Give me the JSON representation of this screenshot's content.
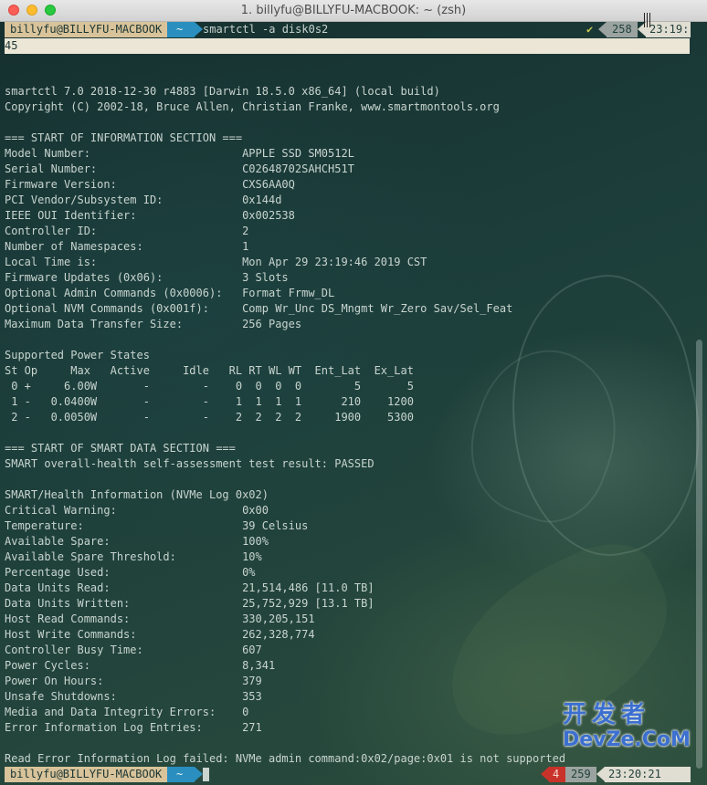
{
  "window": {
    "title": "1. billyfu@BILLYFU-MACBOOK: ~ (zsh)"
  },
  "prompt1": {
    "user": "billyfu@BILLYFU-MACBOOK",
    "dir": "~",
    "command": "smartctl -a disk0s2",
    "status": "✔",
    "history": "258",
    "time": "23:19:",
    "wrapped": "45"
  },
  "output": [
    "",
    "smartctl 7.0 2018-12-30 r4883 [Darwin 18.5.0 x86_64] (local build)",
    "Copyright (C) 2002-18, Bruce Allen, Christian Franke, www.smartmontools.org",
    "",
    "=== START OF INFORMATION SECTION ===",
    "Model Number:                       APPLE SSD SM0512L",
    "Serial Number:                      C02648702SAHCH51T",
    "Firmware Version:                   CXS6AA0Q",
    "PCI Vendor/Subsystem ID:            0x144d",
    "IEEE OUI Identifier:                0x002538",
    "Controller ID:                      2",
    "Number of Namespaces:               1",
    "Local Time is:                      Mon Apr 29 23:19:46 2019 CST",
    "Firmware Updates (0x06):            3 Slots",
    "Optional Admin Commands (0x0006):   Format Frmw_DL",
    "Optional NVM Commands (0x001f):     Comp Wr_Unc DS_Mngmt Wr_Zero Sav/Sel_Feat",
    "Maximum Data Transfer Size:         256 Pages",
    "",
    "Supported Power States",
    "St Op     Max   Active     Idle   RL RT WL WT  Ent_Lat  Ex_Lat",
    " 0 +     6.00W       -        -    0  0  0  0        5       5",
    " 1 -   0.0400W       -        -    1  1  1  1      210    1200",
    " 2 -   0.0050W       -        -    2  2  2  2     1900    5300",
    "",
    "=== START OF SMART DATA SECTION ===",
    "SMART overall-health self-assessment test result: PASSED",
    "",
    "SMART/Health Information (NVMe Log 0x02)",
    "Critical Warning:                   0x00",
    "Temperature:                        39 Celsius",
    "Available Spare:                    100%",
    "Available Spare Threshold:          10%",
    "Percentage Used:                    0%",
    "Data Units Read:                    21,514,486 [11.0 TB]",
    "Data Units Written:                 25,752,929 [13.1 TB]",
    "Host Read Commands:                 330,205,151",
    "Host Write Commands:                262,328,774",
    "Controller Busy Time:               607",
    "Power Cycles:                       8,341",
    "Power On Hours:                     379",
    "Unsafe Shutdowns:                   353",
    "Media and Data Integrity Errors:    0",
    "Error Information Log Entries:      271",
    "",
    "Read Error Information Log failed: NVMe admin command:0x02/page:0x01 is not supported"
  ],
  "prompt2": {
    "user": "billyfu@BILLYFU-MACBOOK",
    "dir": "~",
    "error": "4",
    "history": "259",
    "time": "23:20:21"
  },
  "watermark": {
    "top": "开发者",
    "bottom": "DevZe.CoM"
  }
}
